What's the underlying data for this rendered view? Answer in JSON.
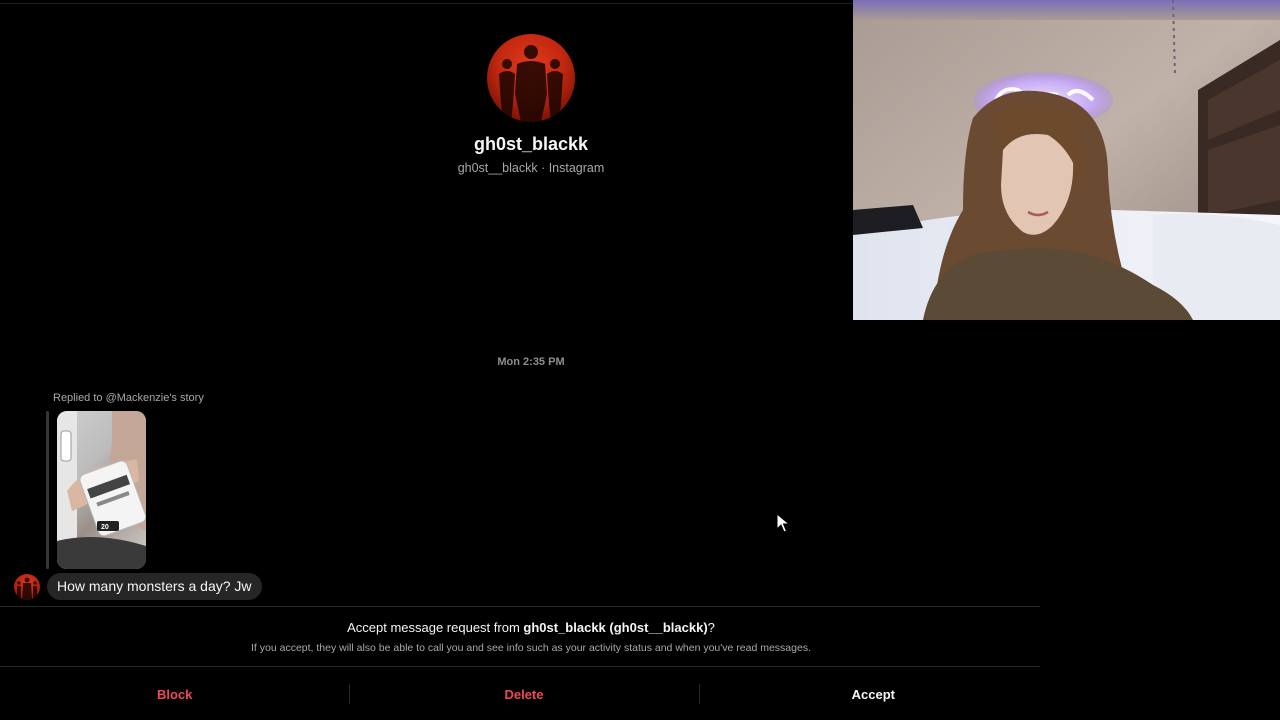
{
  "profile": {
    "name": "gh0st_blackk",
    "subtitle": "gh0st__blackk · Instagram"
  },
  "thread": {
    "timestamp": "Mon 2:35 PM",
    "story_reply_label": "Replied to @Mackenzie's story",
    "story_badge": "20",
    "message": "How many monsters a day? Jw"
  },
  "request": {
    "title_prefix": "Accept message request from ",
    "title_user": "gh0st_blackk (gh0st__blackk)",
    "title_suffix": "?",
    "note": "If you accept, they will also be able to call you and see info such as your activity status and when you've read messages."
  },
  "actions": {
    "block": "Block",
    "delete": "Delete",
    "accept": "Accept"
  },
  "colors": {
    "background": "#000000",
    "bubble": "#262626",
    "danger": "#ed4956",
    "muted": "#a8a8a8"
  },
  "icons": {
    "cursor": "mouse-pointer-icon"
  }
}
